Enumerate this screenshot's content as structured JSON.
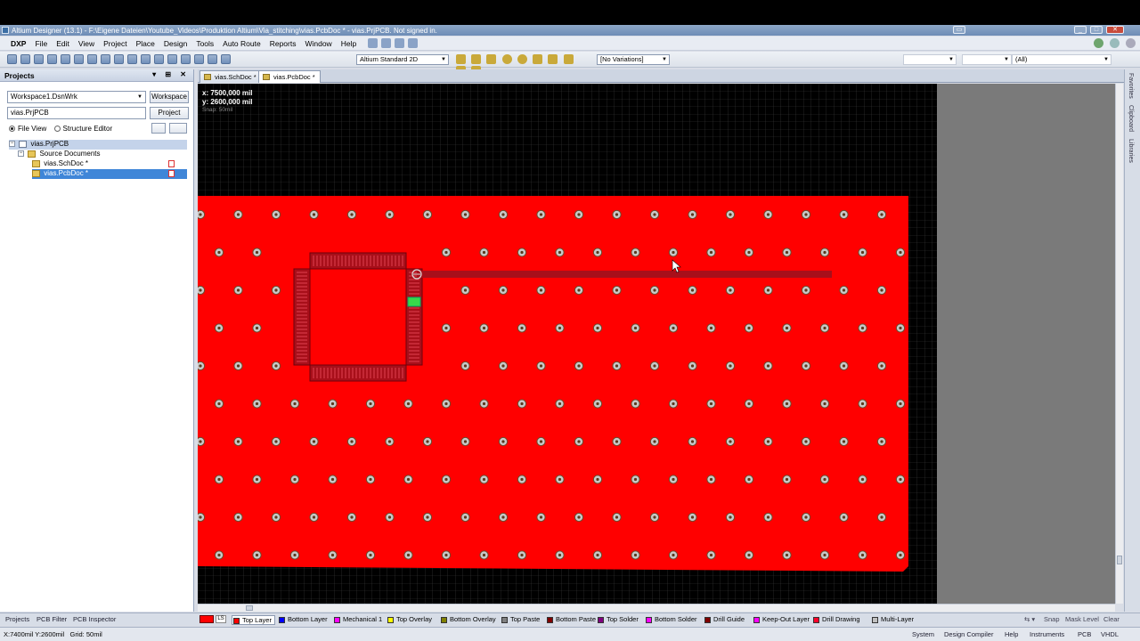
{
  "window": {
    "title": "Altium Designer (13.1) - F:\\Eigene Dateien\\Youtube_Videos\\Produktion Altium\\Via_stitching\\vias.PcbDoc * - vias.PrjPCB. Not signed in."
  },
  "menu": {
    "items": [
      "DXP",
      "File",
      "Edit",
      "View",
      "Project",
      "Place",
      "Design",
      "Tools",
      "Auto Route",
      "Reports",
      "Window",
      "Help"
    ]
  },
  "toolbar": {
    "view_mode": "Altium Standard 2D",
    "variations": "[No Variations]",
    "filter": "(All)"
  },
  "projects_panel": {
    "title": "Projects",
    "workspace_value": "Workspace1.DsnWrk",
    "workspace_button": "Workspace",
    "project_value": "vias.PrjPCB",
    "project_button": "Project",
    "file_view": "File View",
    "structure_editor": "Structure Editor",
    "tree": {
      "project": "vias.PrjPCB",
      "folder": "Source Documents",
      "docs": [
        "vias.SchDoc *",
        "vias.PcbDoc *"
      ]
    }
  },
  "document_tabs": [
    "vias.SchDoc *",
    "vias.PcbDoc *"
  ],
  "canvas": {
    "x_readout": "x: 7500,000 mil",
    "y_readout": "y: 2600,000 mil",
    "snap_readout": "Snap: 50mil"
  },
  "right_panels": [
    "Favorites",
    "Clipboard",
    "Libraries"
  ],
  "bottom_panel_tabs": [
    "Projects",
    "PCB Filter",
    "PCB Inspector"
  ],
  "layers": [
    {
      "name": "Top Layer",
      "color": "#ff0000"
    },
    {
      "name": "Bottom Layer",
      "color": "#0000ff"
    },
    {
      "name": "Mechanical 1",
      "color": "#ff00ff"
    },
    {
      "name": "Top Overlay",
      "color": "#ffff00"
    },
    {
      "name": "Bottom Overlay",
      "color": "#808000"
    },
    {
      "name": "Top Paste",
      "color": "#808080"
    },
    {
      "name": "Bottom Paste",
      "color": "#800000"
    },
    {
      "name": "Top Solder",
      "color": "#800080"
    },
    {
      "name": "Bottom Solder",
      "color": "#ff00ff"
    },
    {
      "name": "Drill Guide",
      "color": "#800000"
    },
    {
      "name": "Keep-Out Layer",
      "color": "#ff00ff"
    },
    {
      "name": "Drill Drawing",
      "color": "#ff002a"
    },
    {
      "name": "Multi-Layer",
      "color": "#c0c0c0"
    }
  ],
  "layer_controls": [
    "Snap",
    "Mask Level",
    "Clear"
  ],
  "status": {
    "position": "X:7400mil Y:2600mil",
    "grid": "Grid: 50mil",
    "buttons": [
      "System",
      "Design Compiler",
      "Help",
      "Instruments",
      "PCB",
      "VHDL"
    ]
  },
  "colors": {
    "copper": "#ff0000",
    "board": "#000000",
    "grid": "#3a3a3a",
    "outside": "#7a7a7a",
    "pad": "#c8c8c8"
  }
}
